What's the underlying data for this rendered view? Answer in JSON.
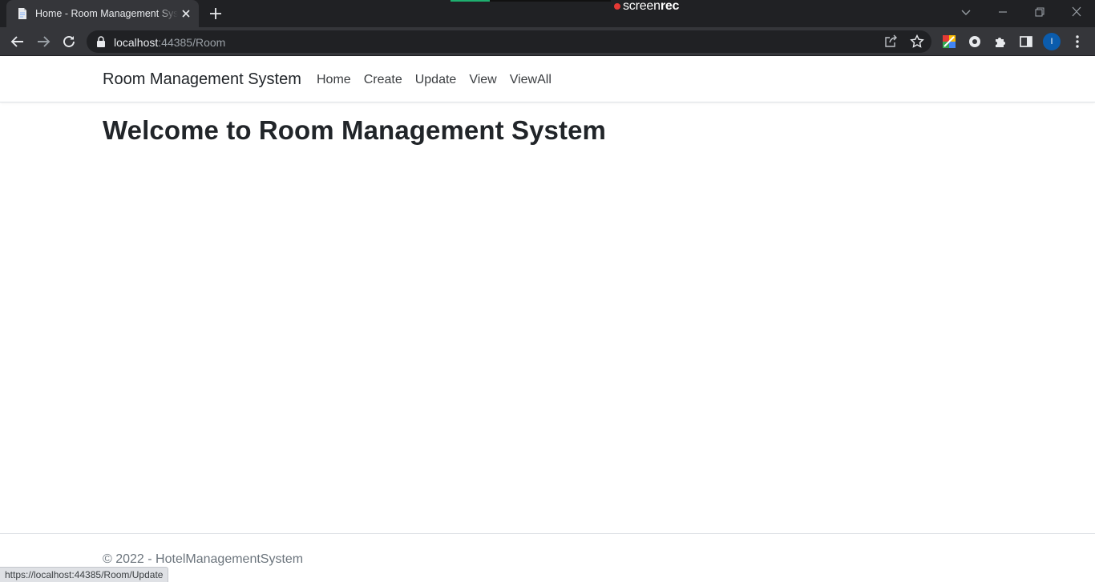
{
  "browser": {
    "tab": {
      "title": "Home - Room Management System",
      "favicon": "page-icon",
      "close_icon": "close-icon"
    },
    "new_tab_icon": "plus-icon",
    "recorder_overlay": {
      "label_light": "screen",
      "label_bold": "rec",
      "dot_color": "#e53935"
    },
    "window_controls": [
      "tab-search-icon",
      "minimize-icon",
      "restore-icon",
      "close-icon"
    ],
    "nav_buttons": [
      "back-arrow-icon",
      "forward-arrow-icon",
      "reload-icon"
    ],
    "address_bar": {
      "host": "localhost",
      "path": ":44385/Room",
      "lock_icon": "lock-icon"
    },
    "omnibox_icons": [
      "share-icon",
      "star-icon"
    ],
    "extension_icons": [
      "extension-colorful-icon",
      "extension-circle-icon",
      "puzzle-icon",
      "side-panel-icon"
    ],
    "profile_initial": "I",
    "menu_icon": "kebab-menu-icon",
    "status_url": "https://localhost:44385/Room/Update"
  },
  "navbar": {
    "brand": "Room Management System",
    "links": [
      {
        "label": "Home"
      },
      {
        "label": "Create"
      },
      {
        "label": "Update"
      },
      {
        "label": "View"
      },
      {
        "label": "ViewAll"
      }
    ]
  },
  "main": {
    "heading": "Welcome to Room Management System"
  },
  "footer": {
    "text": "© 2022 - HotelManagementSystem"
  },
  "colors": {
    "chrome_dark": "#202124",
    "chrome_toolbar": "#35363a",
    "profile_blue": "#0b5cad",
    "text_primary": "#212529",
    "text_muted": "#6c757d",
    "border": "#dee2e6"
  }
}
